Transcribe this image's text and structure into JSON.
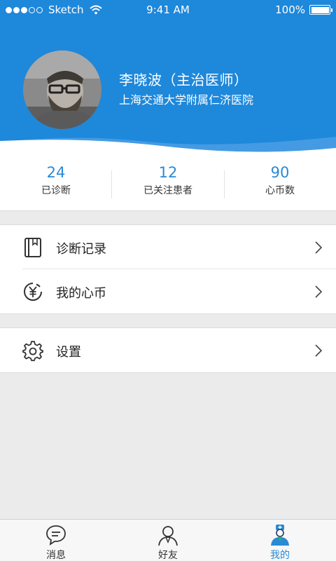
{
  "status_bar": {
    "carrier": "Sketch",
    "time": "9:41 AM",
    "battery": "100%"
  },
  "profile": {
    "name": "李晓波（主治医师）",
    "hospital": "上海交通大学附属仁济医院"
  },
  "stats": [
    {
      "value": "24",
      "label": "已诊断"
    },
    {
      "value": "12",
      "label": "已关注患者"
    },
    {
      "value": "90",
      "label": "心币数"
    }
  ],
  "menu": {
    "diagnosis_records": "诊断记录",
    "my_coins": "我的心币",
    "settings": "设置"
  },
  "tabbar": {
    "messages": "消息",
    "friends": "好友",
    "mine": "我的",
    "active": "mine"
  },
  "colors": {
    "header": "#1e88db",
    "accent": "#2a8ad6",
    "background": "#ebebeb"
  }
}
